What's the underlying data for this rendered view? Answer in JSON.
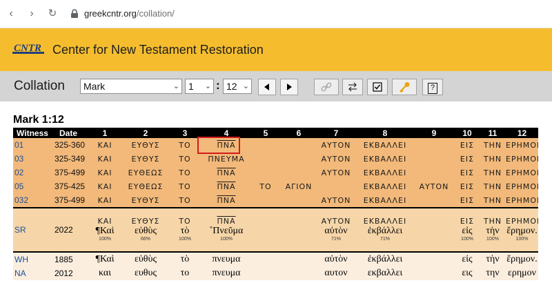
{
  "browser": {
    "url_domain": "greekcntr.org",
    "url_path": "/collation/"
  },
  "site": {
    "logo_text": "CNTR",
    "title": "Center for New Testament Restoration"
  },
  "toolbar": {
    "label": "Collation",
    "book": "Mark",
    "chapter": "1",
    "verse": "12",
    "icons": [
      "prev-icon",
      "next-icon",
      "link-icon",
      "swap-icon",
      "checkbox-icon",
      "key-icon",
      "help-icon"
    ],
    "help_label": "?"
  },
  "reference": "Mark 1:12",
  "headers": [
    "Witness",
    "Date",
    "1",
    "2",
    "3",
    "4",
    "5",
    "6",
    "7",
    "8",
    "9",
    "10",
    "11",
    "12"
  ],
  "manuscripts": [
    {
      "witness": "01",
      "date": "325-360",
      "words": [
        "ΚΑΙ",
        "ΕΥΘΥΣ",
        "ΤΟ",
        "ΠΝΑ",
        "",
        "",
        "ΑΥΤΟΝ",
        "ΕΚΒΑΛΛΕΙ",
        "",
        "ΕΙΣ",
        "ΤΗΝ",
        "ΕΡΗΜΟΝ"
      ]
    },
    {
      "witness": "03",
      "date": "325-349",
      "words": [
        "ΚΑΙ",
        "ΕΥΘΥΣ",
        "ΤΟ",
        "ΠΝΕΥΜΑ",
        "",
        "",
        "ΑΥΤΟΝ",
        "ΕΚΒΑΛΛΕΙ",
        "",
        "ΕΙΣ",
        "ΤΗΝ",
        "ΕΡΗΜΟΝ"
      ]
    },
    {
      "witness": "02",
      "date": "375-499",
      "words": [
        "ΚΑΙ",
        "ΕΥΘΕΩΣ",
        "ΤΟ",
        "ΠΝΑ",
        "",
        "",
        "ΑΥΤΟΝ",
        "ΕΚΒΑΛΛΕΙ",
        "",
        "ΕΙΣ",
        "ΤΗΝ",
        "ΕΡΗΜΟΝ"
      ]
    },
    {
      "witness": "05",
      "date": "375-425",
      "words": [
        "ΚΑΙ",
        "ΕΥΘΕΩΣ",
        "ΤΟ",
        "ΠΝΑ",
        "ΤΟ",
        "ΑΓΙΟΝ",
        "",
        "ΕΚΒΑΛΛΕΙ",
        "ΑΥΤΟΝ",
        "ΕΙΣ",
        "ΤΗΝ",
        "ΕΡΗΜΟΝ"
      ]
    },
    {
      "witness": "032",
      "date": "375-499",
      "words": [
        "ΚΑΙ",
        "ΕΥΘΥΣ",
        "ΤΟ",
        "ΠΝΑ",
        "",
        "",
        "ΑΥΤΟΝ",
        "ΕΚΒΑΛΛΕΙ",
        "",
        "ΕΙΣ",
        "ΤΗΝ",
        "ΕΡΗΜΟΝ"
      ]
    }
  ],
  "sr": {
    "witness": "SR",
    "date": "2022",
    "upper": [
      "ΚΑΙ",
      "ΕΥΘΥΣ",
      "ΤΟ",
      "ΠΝΑ",
      "",
      "",
      "ΑΥΤΟΝ",
      "ΕΚΒΑΛΛΕΙ",
      "",
      "ΕΙΣ",
      "ΤΗΝ",
      "ΕΡΗΜΟΝ"
    ],
    "greek": [
      "¶Καὶ",
      "εὐθὺς",
      "τὸ",
      "˚Πνεῦμα",
      "",
      "",
      "αὐτὸν",
      "ἐκβάλλει",
      "",
      "εἰς",
      "τὴν",
      "ἔρημον."
    ],
    "pct": [
      "100%",
      "66%",
      "100%",
      "100%",
      "",
      "",
      "71%",
      "71%",
      "",
      "100%",
      "100%",
      "100%"
    ]
  },
  "editions": [
    {
      "witness": "WH",
      "date": "1885",
      "words": [
        "¶Καὶ",
        "εὐθὺς",
        "τὸ",
        "πνευμα",
        "",
        "",
        "αὐτὸν",
        "ἐκβάλλει",
        "",
        "εἰς",
        "τὴν",
        "ἔρημον."
      ]
    },
    {
      "witness": "NA",
      "date": "2012",
      "words": [
        "και",
        "ευθυς",
        "το",
        "πνευμα",
        "",
        "",
        "αυτον",
        "εκβαλλει",
        "",
        "εις",
        "την",
        "ερημον"
      ]
    }
  ]
}
